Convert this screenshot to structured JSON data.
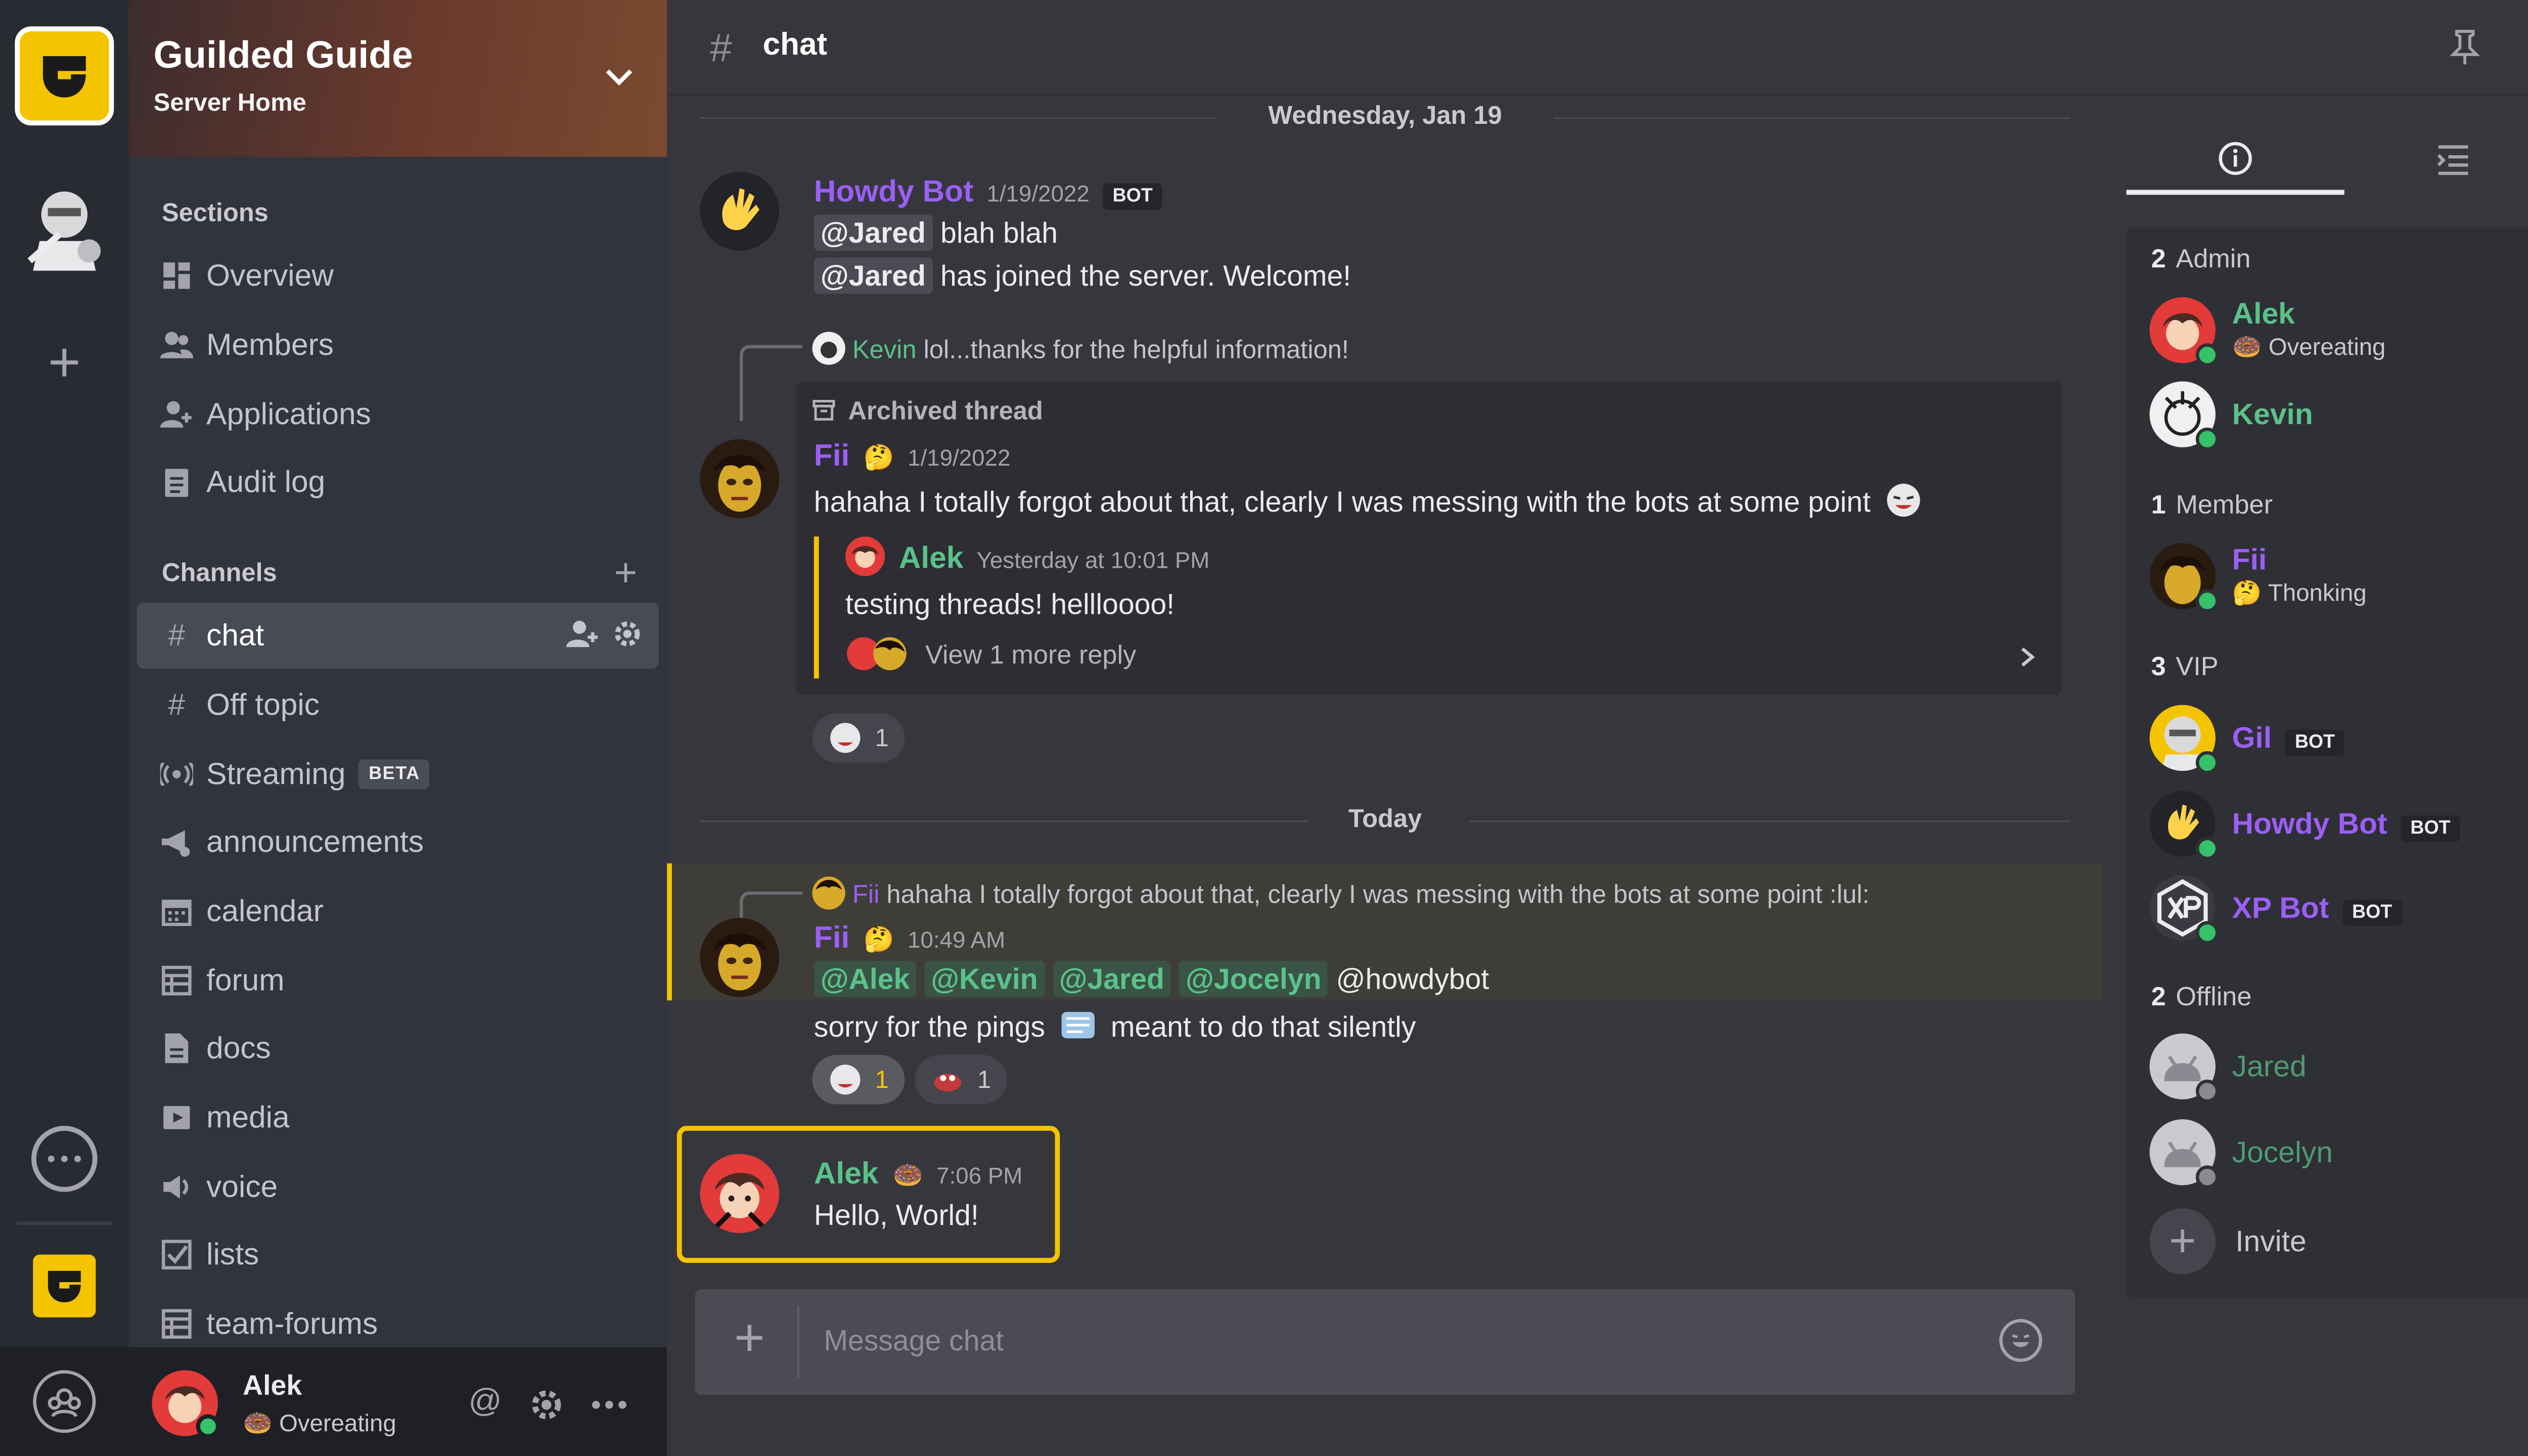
{
  "rail": {
    "icons": [
      "guilded-logo-icon",
      "knight-avatar-icon",
      "plus-icon",
      "chat-bubble-icon",
      "guilded-icon",
      "support-icon"
    ]
  },
  "server": {
    "name": "Guilded Guide",
    "subtitle": "Server Home"
  },
  "sections": {
    "label": "Sections",
    "items": [
      {
        "label": "Overview",
        "icon": "grid-icon"
      },
      {
        "label": "Members",
        "icon": "members-icon"
      },
      {
        "label": "Applications",
        "icon": "add-user-icon"
      },
      {
        "label": "Audit log",
        "icon": "clipboard-icon"
      }
    ]
  },
  "channels": {
    "label": "Channels",
    "items": [
      {
        "label": "chat",
        "icon": "hash-icon"
      },
      {
        "label": "Off topic",
        "icon": "hash-icon"
      },
      {
        "label": "Streaming",
        "icon": "broadcast-icon",
        "badge": "BETA"
      },
      {
        "label": "announcements",
        "icon": "megaphone-icon"
      },
      {
        "label": "calendar",
        "icon": "calendar-icon"
      },
      {
        "label": "forum",
        "icon": "forum-icon"
      },
      {
        "label": "docs",
        "icon": "doc-icon"
      },
      {
        "label": "media",
        "icon": "media-icon"
      },
      {
        "label": "voice",
        "icon": "voice-icon"
      },
      {
        "label": "lists",
        "icon": "checklist-icon"
      },
      {
        "label": "team-forums",
        "icon": "forum-icon"
      }
    ]
  },
  "user_bar": {
    "name": "Alek",
    "status": "🍩 Overeating"
  },
  "topbar": {
    "hash": "#",
    "title": "chat"
  },
  "messages": {
    "date_1": "Wednesday, Jan 19",
    "date_2": "Today",
    "m1": {
      "author": "Howdy Bot",
      "date": "1/19/2022",
      "tag": "BOT",
      "line1_mention": "@Jared",
      "line1_text": "blah blah",
      "line2_mention": "@Jared",
      "line2_text": "has joined the server. Welcome!"
    },
    "reply1": {
      "author": "Kevin",
      "text": "lol...thanks for the helpful information!"
    },
    "thread": {
      "label": "Archived thread",
      "author": "Fii",
      "emoji": "🤔",
      "date": "1/19/2022",
      "text": "hahaha I totally forgot about that, clearly I was messing with the bots at some point",
      "sub_author": "Alek",
      "sub_time": "Yesterday at 10:01 PM",
      "sub_text": "testing threads! hellloooo!",
      "view_more": "View 1 more reply"
    },
    "reaction_1": {
      "count": "1"
    },
    "reply2": {
      "author": "Fii",
      "text": "hahaha I totally forgot about that, clearly I was messing with the bots at some point :lul:"
    },
    "m3": {
      "author": "Fii",
      "emoji": "🤔",
      "time": "10:49 AM",
      "mentions": [
        "@Alek",
        "@Kevin",
        "@Jared",
        "@Jocelyn"
      ],
      "plain_mention": "@howdybot",
      "line2a": "sorry for the pings",
      "line2b": "meant to do that silently",
      "reactions": [
        {
          "count": "1"
        },
        {
          "count": "1"
        }
      ]
    },
    "m4": {
      "author": "Alek",
      "emoji": "🍩",
      "time": "7:06 PM",
      "text": "Hello, World!"
    }
  },
  "composer": {
    "placeholder": "Message chat"
  },
  "members_panel": {
    "groups": [
      {
        "count": "2",
        "label": "Admin"
      },
      {
        "count": "1",
        "label": "Member"
      },
      {
        "count": "3",
        "label": "VIP"
      },
      {
        "count": "2",
        "label": "Offline"
      }
    ],
    "admin": [
      {
        "name": "Alek",
        "status": "🍩 Overeating"
      },
      {
        "name": "Kevin"
      }
    ],
    "member": [
      {
        "name": "Fii",
        "status": "🤔 Thonking"
      }
    ],
    "vip": [
      {
        "name": "Gil",
        "tag": "BOT"
      },
      {
        "name": "Howdy Bot",
        "tag": "BOT"
      },
      {
        "name": "XP Bot",
        "tag": "BOT"
      }
    ],
    "offline": [
      {
        "name": "Jared"
      },
      {
        "name": "Jocelyn"
      }
    ],
    "invite": "Invite"
  },
  "colors": {
    "accent": "#f5c400",
    "admin_green": "#5ac28a",
    "bot_purple": "#9b5ff5",
    "online": "#36c26a"
  }
}
